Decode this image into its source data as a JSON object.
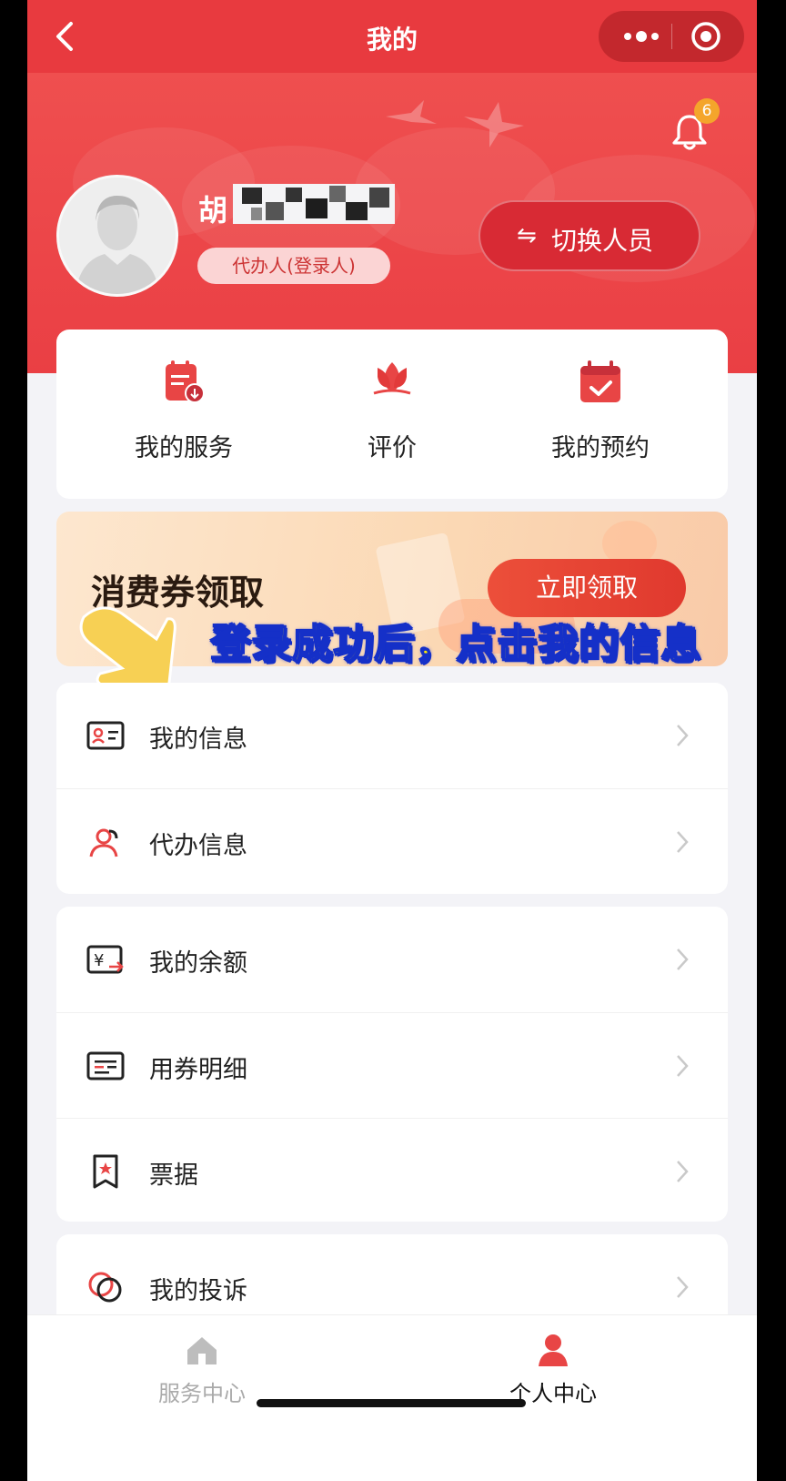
{
  "nav": {
    "title": "我的"
  },
  "header": {
    "notification_count": "6",
    "user_name": "胡",
    "role": "代办人(登录人)",
    "switch_button": "切换人员",
    "switch_icon": "⇋"
  },
  "quick_actions": [
    {
      "label": "我的服务",
      "icon": "calendar-doc-icon"
    },
    {
      "label": "评价",
      "icon": "lotus-icon"
    },
    {
      "label": "我的预约",
      "icon": "calendar-check-icon"
    }
  ],
  "banner": {
    "title": "消费券领取",
    "button": "立即领取"
  },
  "caption": "登录成功后，点击我的信息",
  "menu": {
    "group1": [
      {
        "label": "我的信息",
        "icon": "id-card-icon"
      },
      {
        "label": "代办信息",
        "icon": "agent-user-icon"
      }
    ],
    "group2": [
      {
        "label": "我的余额",
        "icon": "yuan-transfer-icon"
      },
      {
        "label": "用券明细",
        "icon": "coupon-list-icon"
      },
      {
        "label": "票据",
        "icon": "receipt-icon"
      }
    ],
    "group3": [
      {
        "label": "我的投诉",
        "icon": "complaint-icon"
      }
    ]
  },
  "tabbar": [
    {
      "label": "服务中心",
      "active": false
    },
    {
      "label": "个人中心",
      "active": true
    }
  ],
  "colors": {
    "brand_red": "#e83a3f",
    "accent_orange": "#f4a52b",
    "caption_yellow": "#ffee00"
  }
}
